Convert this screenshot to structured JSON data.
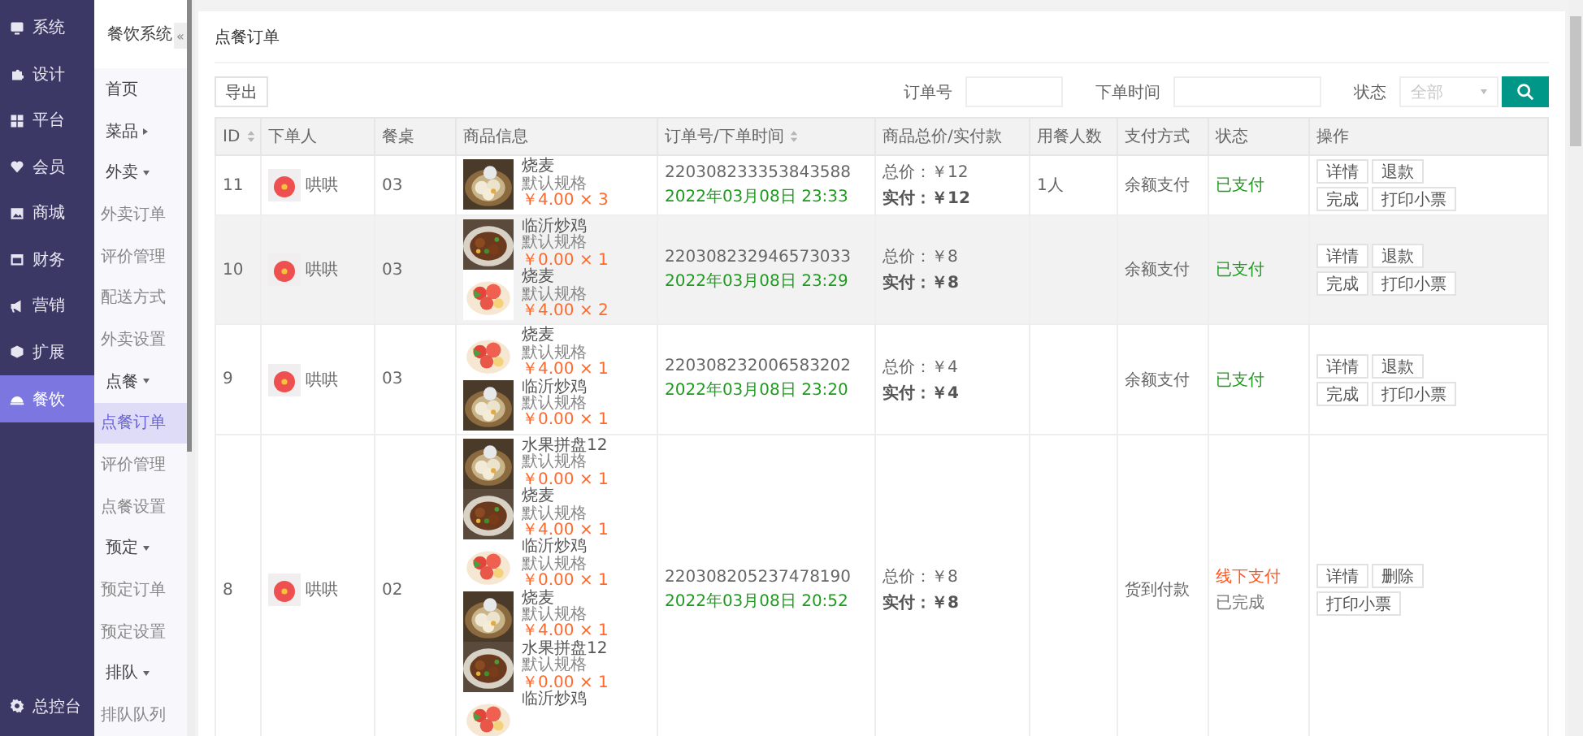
{
  "main_nav": {
    "items": [
      {
        "label": "系统",
        "selected": false
      },
      {
        "label": "设计",
        "selected": false
      },
      {
        "label": "平台",
        "selected": false
      },
      {
        "label": "会员",
        "selected": false
      },
      {
        "label": "商城",
        "selected": false
      },
      {
        "label": "财务",
        "selected": false
      },
      {
        "label": "营销",
        "selected": false
      },
      {
        "label": "扩展",
        "selected": false
      },
      {
        "label": "餐饮",
        "selected": true
      }
    ],
    "footer": {
      "label": "总控台"
    }
  },
  "sub_nav": {
    "title": "餐饮系统",
    "collapse": "«",
    "items": [
      {
        "label": "首页",
        "selected": false
      },
      {
        "label": "菜品",
        "expanded": false
      },
      {
        "label": "外卖",
        "expanded": true,
        "children": [
          {
            "label": "外卖订单",
            "selected": false
          },
          {
            "label": "评价管理",
            "selected": false
          },
          {
            "label": "配送方式",
            "selected": false
          },
          {
            "label": "外卖设置",
            "selected": false
          }
        ]
      },
      {
        "label": "点餐",
        "expanded": true,
        "children": [
          {
            "label": "点餐订单",
            "selected": true
          },
          {
            "label": "评价管理",
            "selected": false
          },
          {
            "label": "点餐设置",
            "selected": false
          }
        ]
      },
      {
        "label": "预定",
        "expanded": true,
        "children": [
          {
            "label": "预定订单",
            "selected": false
          },
          {
            "label": "预定设置",
            "selected": false
          }
        ]
      },
      {
        "label": "排队",
        "expanded": true,
        "children": [
          {
            "label": "排队队列",
            "selected": false
          }
        ]
      }
    ]
  },
  "page": {
    "title": "点餐订单"
  },
  "toolbar": {
    "export": "导出",
    "order_no_label": "订单号",
    "time_label": "下单时间",
    "status_label": "状态",
    "status_placeholder": "全部"
  },
  "table": {
    "columns": [
      {
        "label": "ID",
        "sortable": true
      },
      {
        "label": "下单人",
        "sortable": false
      },
      {
        "label": "餐桌",
        "sortable": false
      },
      {
        "label": "商品信息",
        "sortable": false
      },
      {
        "label": "订单号/下单时间",
        "sortable": true
      },
      {
        "label": "商品总价/实付款",
        "sortable": false
      },
      {
        "label": "用餐人数",
        "sortable": false
      },
      {
        "label": "支付方式",
        "sortable": false
      },
      {
        "label": "状态",
        "sortable": false
      },
      {
        "label": "操作",
        "sortable": false
      }
    ],
    "rows": [
      {
        "selected": false,
        "id": "11",
        "user": "哄哄",
        "table": "03",
        "products": [
          {
            "kind": "picture",
            "name": "烧麦",
            "spec": "默认规格",
            "price": "￥4.00 × 3"
          }
        ],
        "order_no": "220308233353843588",
        "time": "2022年03月08日 23:33",
        "total": "总价：￥12",
        "paid": "实付：￥12",
        "diners": "1人",
        "payment": "余额支付",
        "statuses": [
          {
            "text": "已支付",
            "color": "#1e9a1e"
          }
        ],
        "actions": [
          "详情",
          "退款",
          "完成",
          "打印小票"
        ]
      },
      {
        "selected": true,
        "id": "10",
        "user": "哄哄",
        "table": "03",
        "products": [
          {
            "kind": "picture",
            "name": "临沂炒鸡",
            "spec": "默认规格",
            "price": "￥0.00 × 1"
          },
          {
            "kind": "picture",
            "name": "烧麦",
            "spec": "默认规格",
            "price": "￥4.00 × 2"
          }
        ],
        "order_no": "220308232946573033",
        "time": "2022年03月08日 23:29",
        "total": "总价：￥8",
        "paid": "实付：￥8",
        "payment": "余额支付",
        "statuses": [
          {
            "text": "已支付",
            "color": "#1e9a1e"
          }
        ],
        "actions": [
          "详情",
          "退款",
          "完成",
          "打印小票"
        ]
      },
      {
        "selected": false,
        "id": "9",
        "user": "哄哄",
        "table": "03",
        "products": [
          {
            "kind": "picture",
            "name": "烧麦",
            "spec": "默认规格",
            "price": "￥4.00 × 1"
          },
          {
            "kind": "picture",
            "name": "临沂炒鸡",
            "spec": "默认规格",
            "price": "￥0.00 × 1"
          }
        ],
        "order_no": "220308232006583202",
        "time": "2022年03月08日 23:20",
        "total": "总价：￥4",
        "paid": "实付：￥4",
        "payment": "余额支付",
        "statuses": [
          {
            "text": "已支付",
            "color": "#1e9a1e"
          }
        ],
        "actions": [
          "详情",
          "退款",
          "完成",
          "打印小票"
        ]
      },
      {
        "selected": false,
        "id": "8",
        "user": "哄哄",
        "table": "02",
        "products": [
          {
            "kind": "picture",
            "name": "水果拼盘12",
            "spec": "默认规格",
            "price": "￥0.00 × 1"
          },
          {
            "kind": "picture",
            "name": "烧麦",
            "spec": "默认规格",
            "price": "￥4.00 × 1"
          },
          {
            "kind": "picture",
            "name": "临沂炒鸡",
            "spec": "默认规格",
            "price": "￥0.00 × 1"
          },
          {
            "kind": "picture",
            "name": "烧麦",
            "spec": "默认规格",
            "price": "￥4.00 × 1"
          },
          {
            "kind": "picture",
            "name": "水果拼盘12",
            "spec": "默认规格",
            "price": "￥0.00 × 1"
          },
          {
            "kind": "picture",
            "name": "临沂炒鸡"
          }
        ],
        "order_no": "220308205237478190",
        "time": "2022年03月08日 20:52",
        "total": "总价：￥8",
        "paid": "实付：￥8",
        "payment": "货到付款",
        "statuses": [
          {
            "text": "线下支付",
            "color": "#ff5722"
          },
          {
            "text": "已完成",
            "color": "#777777"
          }
        ],
        "actions": [
          "详情",
          "删除",
          "打印小票"
        ]
      }
    ]
  }
}
